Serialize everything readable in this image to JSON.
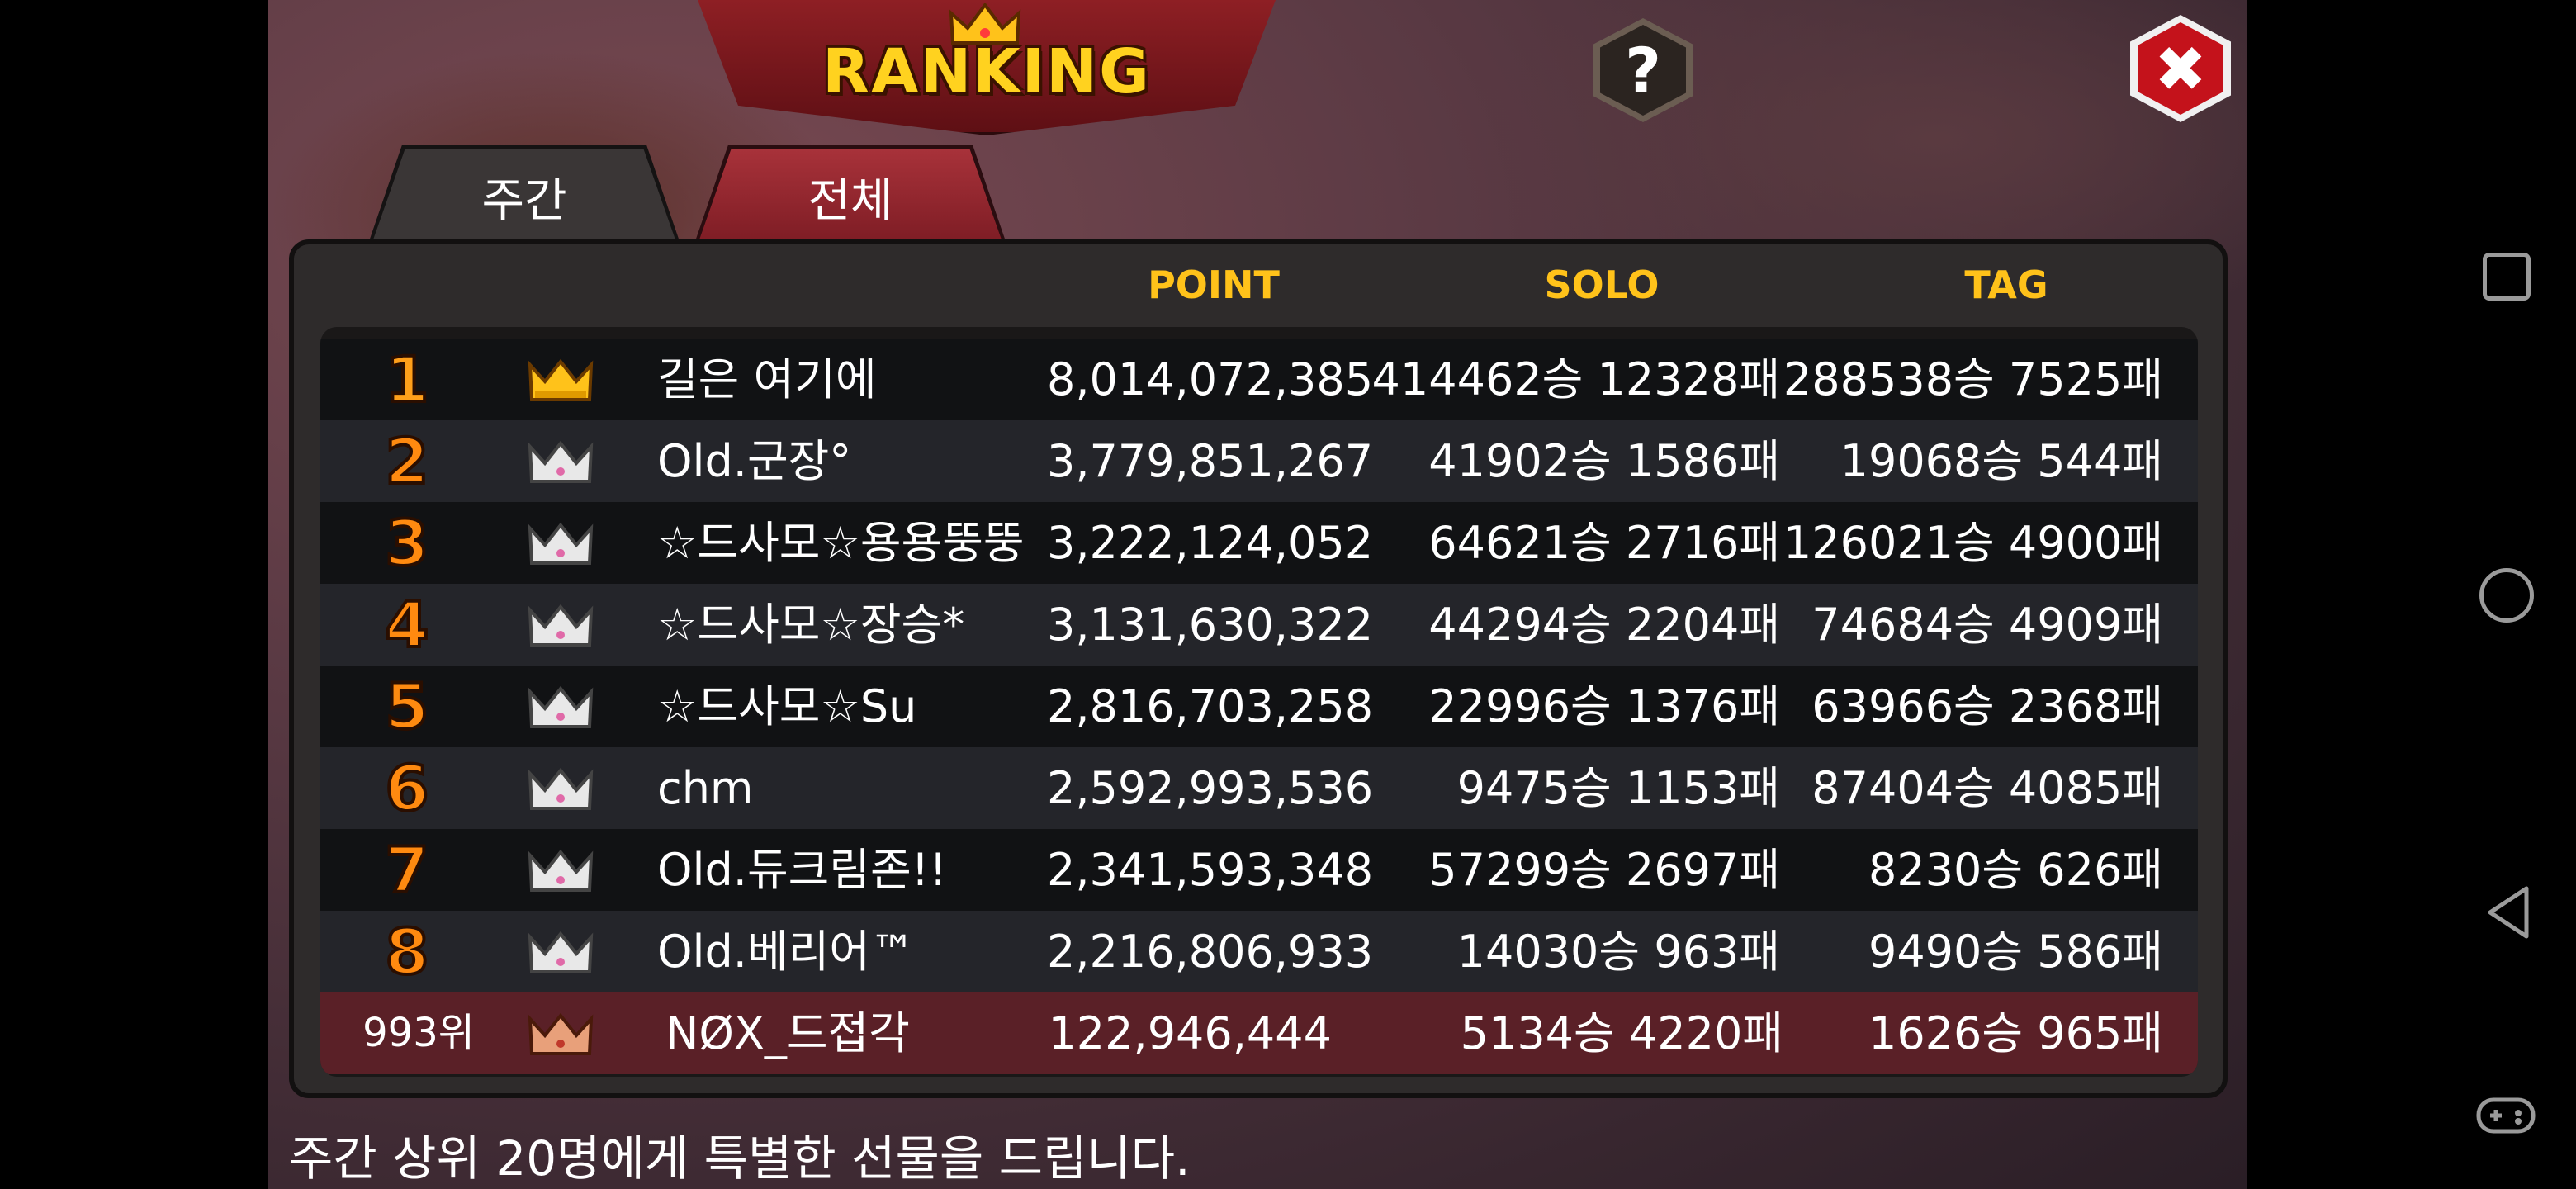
{
  "header": {
    "title": "RANKING",
    "help_label": "?",
    "close_label": "✖"
  },
  "tabs": [
    {
      "label": "주간",
      "selected": false
    },
    {
      "label": "전체",
      "selected": true
    }
  ],
  "columns": {
    "point": "POINT",
    "solo": "SOLO",
    "tag": "TAG"
  },
  "rows": [
    {
      "rank": "1",
      "crown": "gold-crown-icon",
      "name": "길은 여기에",
      "point": "8,014,072,385",
      "solo": "414462승 12328패",
      "tag": "288538승 7525패"
    },
    {
      "rank": "2",
      "crown": "silver-crown-icon",
      "name": "Old.군장°",
      "point": "3,779,851,267",
      "solo": "41902승 1586패",
      "tag": "19068승 544패"
    },
    {
      "rank": "3",
      "crown": "silver-crown-icon",
      "name": "☆드사모☆용용뚱뚱",
      "point": "3,222,124,052",
      "solo": "64621승 2716패",
      "tag": "126021승 4900패"
    },
    {
      "rank": "4",
      "crown": "silver-crown-icon",
      "name": "☆드사모☆장승*",
      "point": "3,131,630,322",
      "solo": "44294승 2204패",
      "tag": "74684승 4909패"
    },
    {
      "rank": "5",
      "crown": "silver-crown-icon",
      "name": "☆드사모☆Su",
      "point": "2,816,703,258",
      "solo": "22996승 1376패",
      "tag": "63966승 2368패"
    },
    {
      "rank": "6",
      "crown": "silver-crown-icon",
      "name": "chm",
      "point": "2,592,993,536",
      "solo": "9475승 1153패",
      "tag": "87404승 4085패"
    },
    {
      "rank": "7",
      "crown": "silver-crown-icon",
      "name": "Old.듀크림존!!",
      "point": "2,341,593,348",
      "solo": "57299승 2697패",
      "tag": "8230승 626패"
    },
    {
      "rank": "8",
      "crown": "silver-crown-icon",
      "name": "Old.베리어™",
      "point": "2,216,806,933",
      "solo": "14030승 963패",
      "tag": "9490승 586패"
    }
  ],
  "my_row": {
    "rank": "993위",
    "crown": "bronze-crown-icon",
    "name": "NØX_드접각",
    "point": "122,946,444",
    "solo": "5134승 4220패",
    "tag": "1626승 965패"
  },
  "notice": "주간 상위 20명에게 특별한 선물을 드립니다.",
  "colors": {
    "accent_gold": "#ffc21a",
    "rank_orange": "#ff8a10",
    "tab_active": "#a8323a",
    "close_red": "#c4121b"
  }
}
